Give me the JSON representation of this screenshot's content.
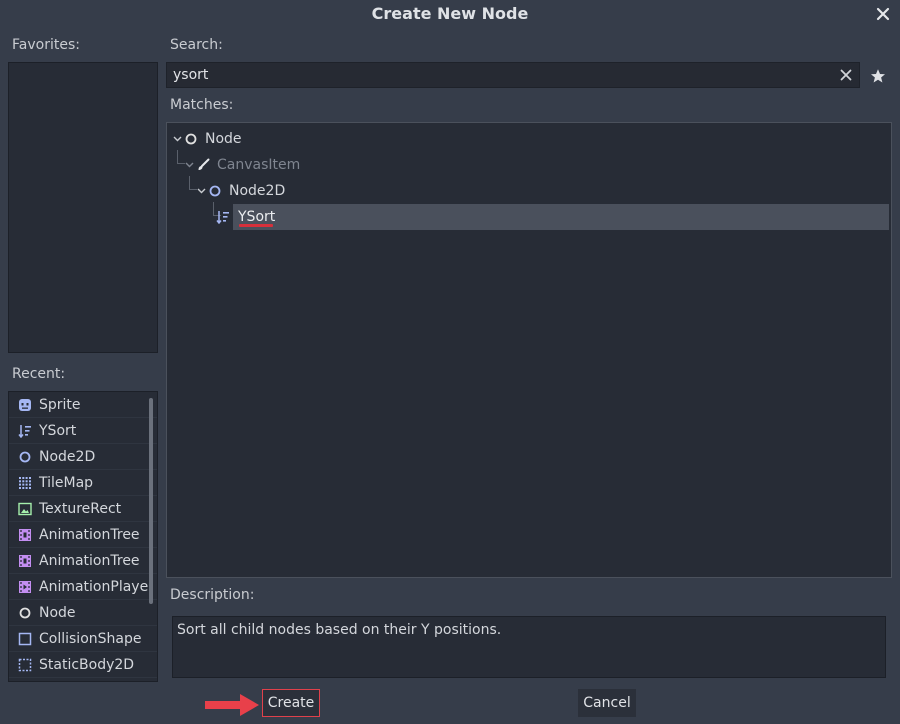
{
  "window": {
    "title": "Create New Node"
  },
  "favorites": {
    "label": "Favorites:"
  },
  "search": {
    "label": "Search:",
    "value": "ysort"
  },
  "matches": {
    "label": "Matches:",
    "tree": [
      {
        "label": "Node",
        "icon": "circle-icon",
        "dim": false
      },
      {
        "label": "CanvasItem",
        "icon": "brush-icon",
        "dim": true
      },
      {
        "label": "Node2D",
        "icon": "circle-icon",
        "dim": false
      },
      {
        "label": "YSort",
        "icon": "ysort-icon",
        "dim": false,
        "selected": true
      }
    ]
  },
  "recent": {
    "label": "Recent:",
    "items": [
      {
        "label": "Sprite",
        "icon": "sprite-icon"
      },
      {
        "label": "YSort",
        "icon": "ysort-icon"
      },
      {
        "label": "Node2D",
        "icon": "circle-icon"
      },
      {
        "label": "TileMap",
        "icon": "tilemap-icon"
      },
      {
        "label": "TextureRect",
        "icon": "texture-rect-icon"
      },
      {
        "label": "AnimationTree",
        "icon": "animation-tree-icon"
      },
      {
        "label": "AnimationTree",
        "icon": "animation-tree-icon"
      },
      {
        "label": "AnimationPlaye",
        "icon": "animation-player-icon"
      },
      {
        "label": "Node",
        "icon": "circle-icon"
      },
      {
        "label": "CollisionShape",
        "icon": "collision-shape-icon"
      },
      {
        "label": "StaticBody2D",
        "icon": "static-body-icon"
      }
    ]
  },
  "description": {
    "label": "Description:",
    "text": "Sort all child nodes based on their Y positions."
  },
  "buttons": {
    "create": "Create",
    "cancel": "Cancel"
  },
  "colors": {
    "background": "#363d4a",
    "panel": "#272c36",
    "selection": "#4a505c",
    "accent_red": "#e0414b",
    "icon_2d": "#a5b7f3",
    "icon_control": "#a5efac",
    "icon_anim": "#c38ef1"
  }
}
